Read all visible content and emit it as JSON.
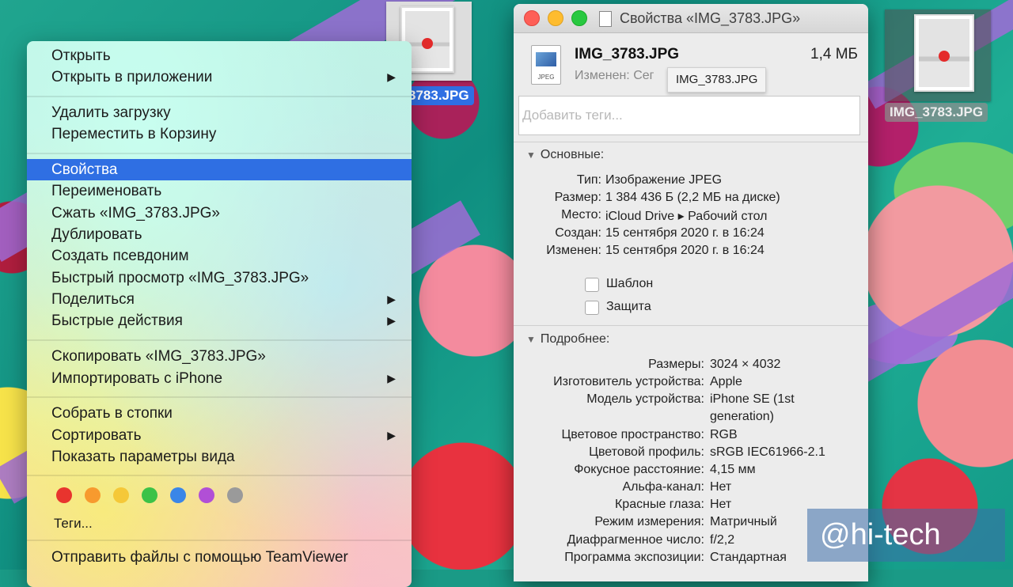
{
  "desktop": {
    "file_label": "IMG_3783.JPG",
    "file_label_partial": "3783.JPG"
  },
  "context_menu": {
    "items": [
      {
        "label": "Открыть"
      },
      {
        "label": "Открыть в приложении",
        "submenu": true
      },
      {
        "label": "Удалить загрузку"
      },
      {
        "label": "Переместить в Корзину"
      },
      {
        "label": "Свойства",
        "selected": true
      },
      {
        "label": "Переименовать"
      },
      {
        "label": "Сжать «IMG_3783.JPG»"
      },
      {
        "label": "Дублировать"
      },
      {
        "label": "Создать псевдоним"
      },
      {
        "label": "Быстрый просмотр «IMG_3783.JPG»"
      },
      {
        "label": "Поделиться",
        "submenu": true
      },
      {
        "label": "Быстрые действия",
        "submenu": true
      },
      {
        "label": "Скопировать «IMG_3783.JPG»"
      },
      {
        "label": "Импортировать с iPhone",
        "submenu": true
      },
      {
        "label": "Собрать в стопки"
      },
      {
        "label": "Сортировать",
        "submenu": true
      },
      {
        "label": "Показать параметры вида"
      },
      {
        "label": "Теги..."
      },
      {
        "label": "Отправить файлы с помощью TeamViewer"
      }
    ],
    "submenu_arrow": "▶",
    "tag_colors": [
      "#e8342e",
      "#f79a2e",
      "#f5c838",
      "#3cc247",
      "#3a86e8",
      "#b14fd6",
      "#9a9a9a"
    ]
  },
  "info_window": {
    "title": "Свойства «IMG_3783.JPG»",
    "file_icon_label": "JPEG",
    "file_name": "IMG_3783.JPG",
    "file_size": "1,4 МБ",
    "modified_partial": "Изменен: Сег",
    "tooltip": "IMG_3783.JPG",
    "tags_placeholder": "Добавить теги...",
    "general": {
      "header": "Основные:",
      "rows": [
        {
          "k": "Тип:",
          "v": "Изображение JPEG"
        },
        {
          "k": "Размер:",
          "v": "1 384 436 Б (2,2 МБ на диске)"
        },
        {
          "k": "Место:",
          "v": "iCloud Drive ▸ Рабочий стол"
        },
        {
          "k": "Создан:",
          "v": "15 сентября 2020 г. в 16:24"
        },
        {
          "k": "Изменен:",
          "v": "15 сентября 2020 г. в 16:24"
        }
      ],
      "template_label": "Шаблон",
      "locked_label": "Защита"
    },
    "more": {
      "header": "Подробнее:",
      "rows": [
        {
          "k": "Размеры:",
          "v": "3024 × 4032"
        },
        {
          "k": "Изготовитель устройства:",
          "v": "Apple"
        },
        {
          "k": "Модель устройства:",
          "v": "iPhone SE (1st",
          "v2": "generation)"
        },
        {
          "k": "Цветовое пространство:",
          "v": "RGB"
        },
        {
          "k": "Цветовой профиль:",
          "v": "sRGB IEC61966-2.1"
        },
        {
          "k": "Фокусное расстояние:",
          "v": "4,15 мм"
        },
        {
          "k": "Альфа-канал:",
          "v": "Нет"
        },
        {
          "k": "Красные глаза:",
          "v": "Нет"
        },
        {
          "k": "Режим измерения:",
          "v": "Матричный"
        },
        {
          "k": "Диафрагменное число:",
          "v": "f/2,2"
        },
        {
          "k": "Программа экспозиции:",
          "v": "Стандартная"
        }
      ]
    }
  },
  "watermark": {
    "text": "@hi-tech"
  }
}
